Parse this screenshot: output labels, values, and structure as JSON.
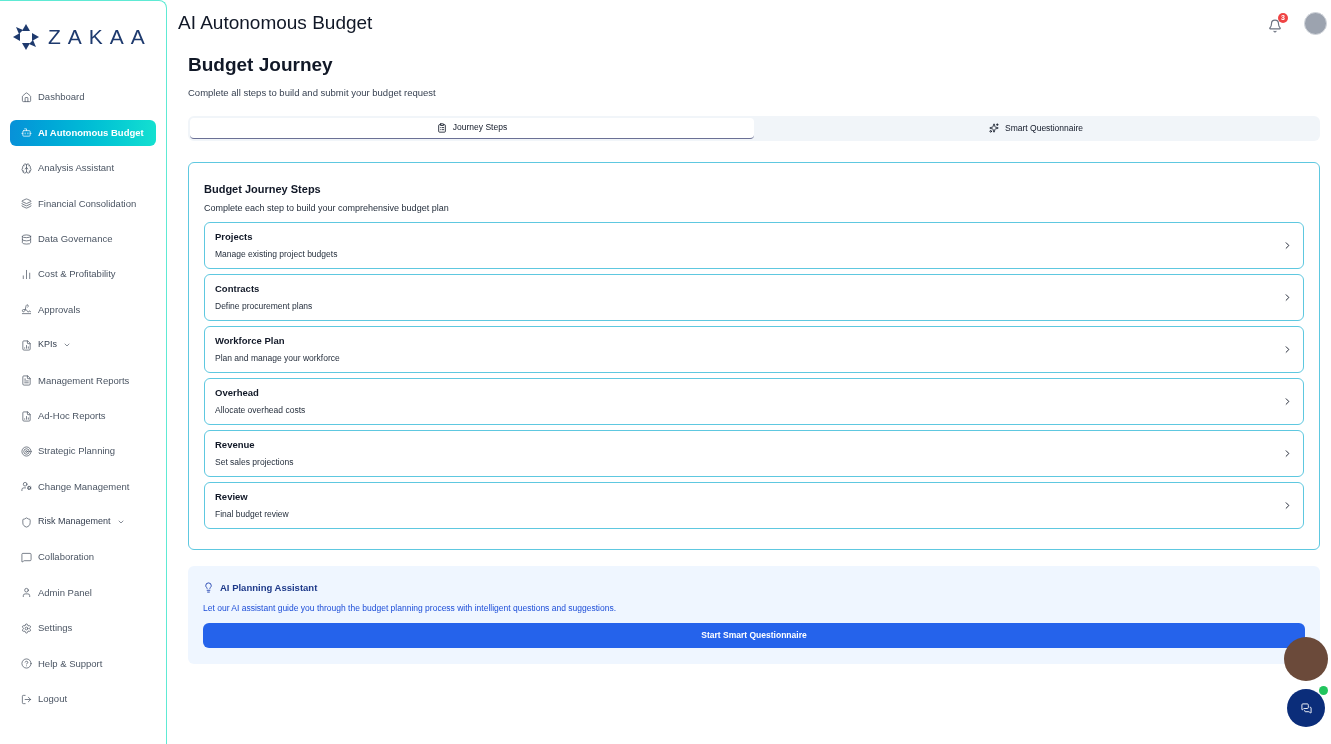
{
  "brand": {
    "name": "ZAKAA"
  },
  "sidebar": {
    "items": [
      {
        "label": "Dashboard",
        "selected": false,
        "has_submenu": false
      },
      {
        "label": "AI Autonomous Budget",
        "selected": true,
        "has_submenu": false
      },
      {
        "label": "Analysis Assistant",
        "selected": false,
        "has_submenu": false
      },
      {
        "label": "Financial Consolidation",
        "selected": false,
        "has_submenu": false
      },
      {
        "label": "Data Governance",
        "selected": false,
        "has_submenu": false
      },
      {
        "label": "Cost & Profitability",
        "selected": false,
        "has_submenu": false
      },
      {
        "label": "Approvals",
        "selected": false,
        "has_submenu": false
      },
      {
        "label": "KPIs",
        "selected": false,
        "has_submenu": true
      },
      {
        "label": "Management Reports",
        "selected": false,
        "has_submenu": false
      },
      {
        "label": "Ad-Hoc Reports",
        "selected": false,
        "has_submenu": false
      },
      {
        "label": "Strategic Planning",
        "selected": false,
        "has_submenu": false
      },
      {
        "label": "Change Management",
        "selected": false,
        "has_submenu": false
      },
      {
        "label": "Risk Management",
        "selected": false,
        "has_submenu": true
      },
      {
        "label": "Collaboration",
        "selected": false,
        "has_submenu": false
      },
      {
        "label": "Admin Panel",
        "selected": false,
        "has_submenu": false
      },
      {
        "label": "Settings",
        "selected": false,
        "has_submenu": false
      },
      {
        "label": "Help & Support",
        "selected": false,
        "has_submenu": false
      },
      {
        "label": "Logout",
        "selected": false,
        "has_submenu": false
      }
    ]
  },
  "header": {
    "title": "AI Autonomous Budget",
    "notification_count": "3"
  },
  "page": {
    "title": "Budget Journey",
    "subtitle": "Complete all steps to build and submit your budget request"
  },
  "tabs": [
    {
      "label": "Journey Steps",
      "selected": true
    },
    {
      "label": "Smart Questionnaire",
      "selected": false
    }
  ],
  "steps_card": {
    "title": "Budget Journey Steps",
    "subtitle": "Complete each step to build your comprehensive budget plan",
    "steps": [
      {
        "title": "Projects",
        "description": "Manage existing project budgets"
      },
      {
        "title": "Contracts",
        "description": "Define procurement plans"
      },
      {
        "title": "Workforce Plan",
        "description": "Plan and manage your workforce"
      },
      {
        "title": "Overhead",
        "description": "Allocate overhead costs"
      },
      {
        "title": "Revenue",
        "description": "Set sales projections"
      },
      {
        "title": "Review",
        "description": "Final budget review"
      }
    ]
  },
  "assistant": {
    "title": "AI Planning Assistant",
    "description": "Let our AI assistant guide you through the budget planning process with intelligent questions and suggestions.",
    "button": "Start Smart Questionnaire"
  },
  "chat": {
    "online": true
  }
}
